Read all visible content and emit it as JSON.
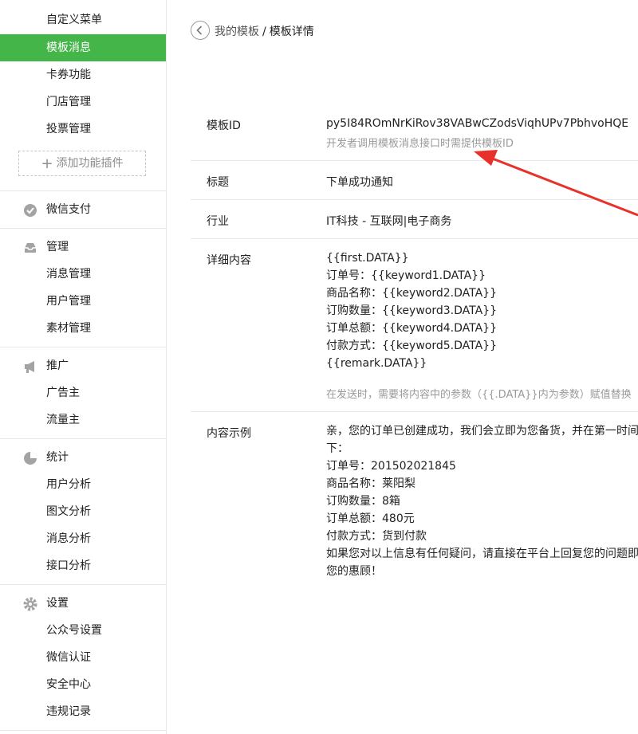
{
  "sidebar": {
    "top_items": [
      "自定义菜单",
      "模板消息",
      "卡券功能",
      "门店管理",
      "投票管理"
    ],
    "add_plugin": "添加功能插件",
    "pay_section": "微信支付",
    "manage_section": {
      "title": "管理",
      "items": [
        "消息管理",
        "用户管理",
        "素材管理"
      ]
    },
    "promote_section": {
      "title": "推广",
      "items": [
        "广告主",
        "流量主"
      ]
    },
    "stats_section": {
      "title": "统计",
      "items": [
        "用户分析",
        "图文分析",
        "消息分析",
        "接口分析"
      ]
    },
    "settings_section": {
      "title": "设置",
      "items": [
        "公众号设置",
        "微信认证",
        "安全中心",
        "违规记录"
      ]
    },
    "accent_color": "#44b549"
  },
  "breadcrumb": {
    "parent": "我的模板",
    "separator": "/",
    "current": "模板详情"
  },
  "template": {
    "id_label": "模板ID",
    "id_value": "py5I84ROmNrKiRov38VABwCZodsViqhUPv7PbhvoHQE",
    "id_hint": "开发者调用模板消息接口时需提供模板ID",
    "title_label": "标题",
    "title_value": "下单成功通知",
    "industry_label": "行业",
    "industry_value": "IT科技 - 互联网|电子商务",
    "content_label": "详细内容",
    "content_lines": [
      "{{first.DATA}}",
      "订单号：{{keyword1.DATA}}",
      "商品名称：{{keyword2.DATA}}",
      "订购数量：{{keyword3.DATA}}",
      "订单总额：{{keyword4.DATA}}",
      "付款方式：{{keyword5.DATA}}",
      "{{remark.DATA}}"
    ],
    "content_hint": "在发送时，需要将内容中的参数（{{.DATA}}内为参数）赋值替换",
    "example_label": "内容示例",
    "example_lines": [
      "亲，您的订单已创建成功，我们会立即为您备货，并在第一时间",
      "下：",
      "订单号：201502021845",
      "商品名称：莱阳梨",
      "订购数量：8箱",
      "订单总额：480元",
      "付款方式：货到付款",
      "如果您对以上信息有任何疑问，请直接在平台上回复您的问题即",
      "您的惠顾！"
    ],
    "arrow_color": "#e8312b"
  }
}
